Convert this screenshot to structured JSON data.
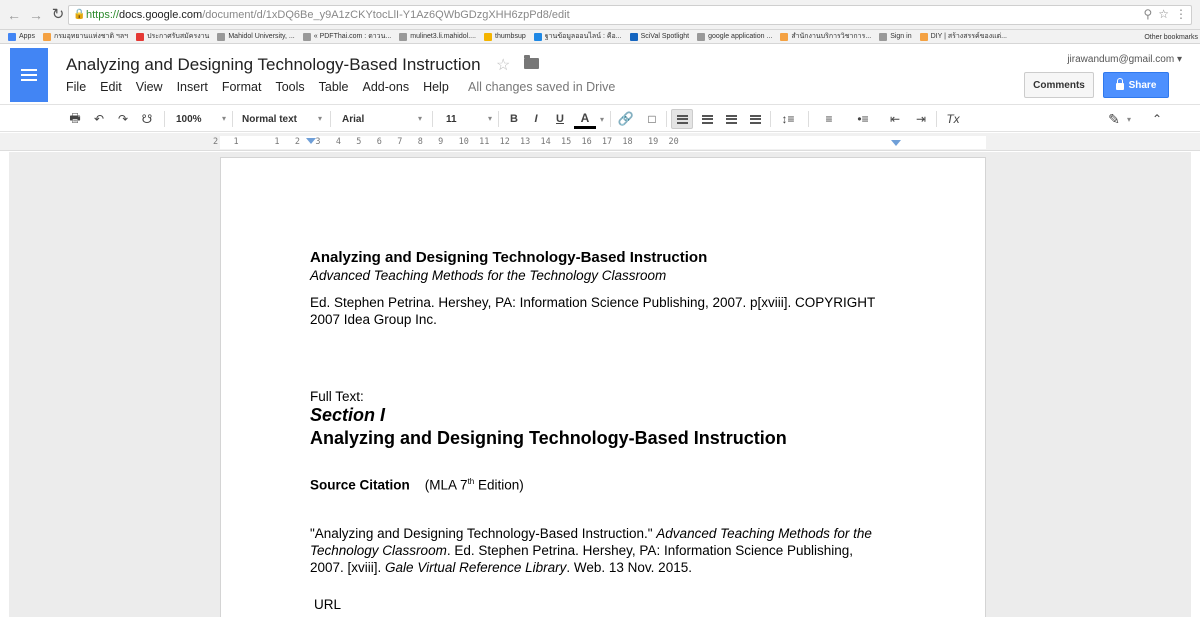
{
  "browser": {
    "url_scheme": "https://",
    "url_host": "docs.google.com",
    "url_path": "/document/d/1xDQ6Be_y9A1zCKYtocLlI-Y1Az6QWbGDzgXHH6zpPd8/edit",
    "bookmarks": [
      {
        "label": "Apps",
        "color": "#4285f4"
      },
      {
        "label": "กรมอุทยานแห่งชาติ ฯลฯ",
        "color": "#f4a142"
      },
      {
        "label": "ประกาศรับสมัครงาน",
        "color": "#e53935"
      },
      {
        "label": "Mahidol University, ...",
        "color": "#999999"
      },
      {
        "label": "« PDFThai.com : ดาวน...",
        "color": "#999999"
      },
      {
        "label": "mulinet3.li.mahidol....",
        "color": "#999999"
      },
      {
        "label": "thumbsup",
        "color": "#f4b400"
      },
      {
        "label": "ฐานข้อมูลออนไลน์ : คือ...",
        "color": "#1e88e5"
      },
      {
        "label": "SciVal Spotlight",
        "color": "#1565c0"
      },
      {
        "label": "google application ...",
        "color": "#999999"
      },
      {
        "label": "สำนักงานบริการวิชาการ...",
        "color": "#f4a142"
      },
      {
        "label": "Sign in",
        "color": "#999999"
      },
      {
        "label": "DIY | สร้างสรรค์ของแต่...",
        "color": "#f4a142"
      }
    ],
    "other_bookmarks": "Other bookmarks"
  },
  "docs": {
    "title": "Analyzing and Designing Technology-Based Instruction",
    "menu": [
      "File",
      "Edit",
      "View",
      "Insert",
      "Format",
      "Tools",
      "Table",
      "Add-ons",
      "Help"
    ],
    "save_status": "All changes saved in Drive",
    "account": "jirawandum@gmail.com",
    "comments_label": "Comments",
    "share_label": "Share"
  },
  "toolbar": {
    "zoom": "100%",
    "style": "Normal text",
    "font": "Arial",
    "size": "11",
    "bold": "B",
    "italic": "I",
    "underline": "U",
    "text_color": "A",
    "clear_format": "Tx"
  },
  "ruler": {
    "ticks": "2   1       1   2   3   4   5   6   7   8   9   10  11  12  13  14  15  16  17  18   19  20"
  },
  "document": {
    "heading": "Analyzing and Designing Technology-Based Instruction",
    "subheading": "Advanced Teaching Methods for the Technology Classroom",
    "citation_line1": "Ed. Stephen Petrina. Hershey, PA: Information Science Publishing, 2007. p[xviii].  COPYRIGHT",
    "citation_line2": "2007 Idea Group Inc.",
    "full_text_label": "Full Text:",
    "section_label": "Section I",
    "section_title": "Analyzing and Designing Technology-Based Instruction",
    "source_citation_label": "Source Citation",
    "mla_prefix": "(MLA 7",
    "mla_sup": "th",
    "mla_suffix": " Edition)",
    "ref_part1": "\"Analyzing and Designing Technology-Based Instruction.\" ",
    "ref_italic1": "Advanced Teaching Methods for the",
    "ref_italic2": "Technology Classroom",
    "ref_part2": ". Ed. Stephen Petrina. Hershey, PA: Information Science Publishing,",
    "ref_part3": "2007. [xviii]. ",
    "ref_italic3": "Gale Virtual Reference Library",
    "ref_part4": ". Web. 13 Nov. 2015.",
    "url_label": "URL"
  }
}
